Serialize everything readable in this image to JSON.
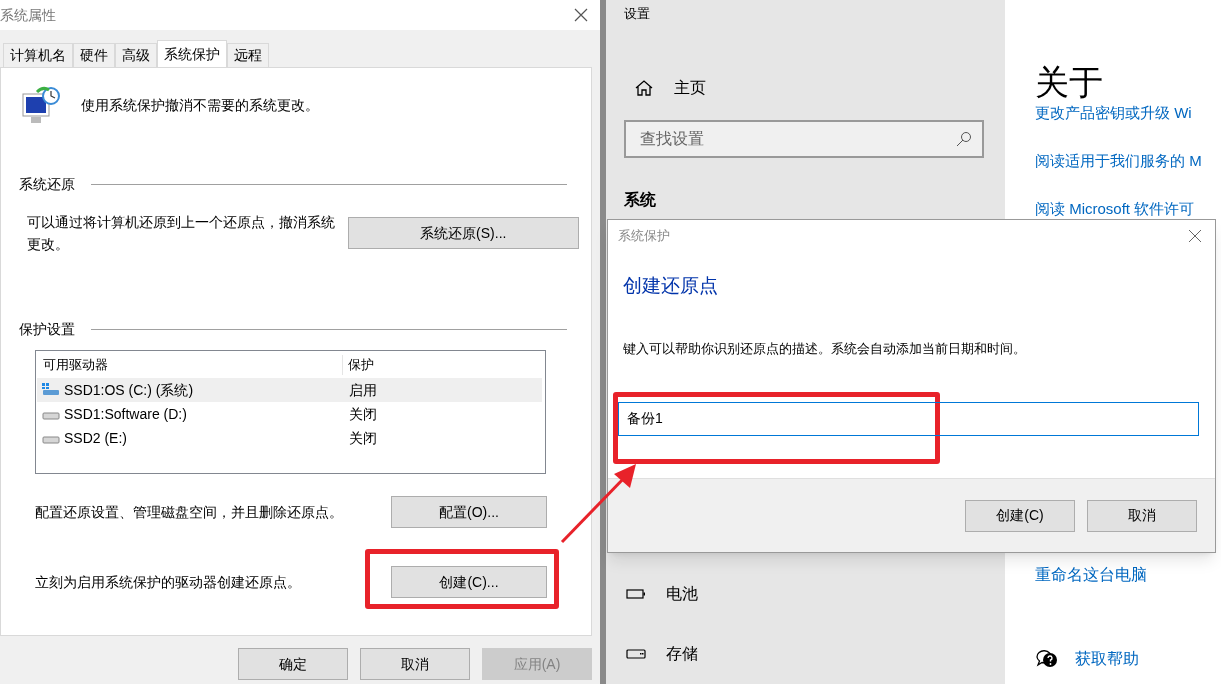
{
  "system_properties": {
    "title": "系统属性",
    "tabs": [
      {
        "label": "计算机名",
        "selected": false
      },
      {
        "label": "硬件",
        "selected": false
      },
      {
        "label": "高级",
        "selected": false
      },
      {
        "label": "系统保护",
        "selected": true
      },
      {
        "label": "远程",
        "selected": false
      }
    ],
    "intro": "使用系统保护撤消不需要的系统更改。",
    "restore": {
      "heading": "系统还原",
      "text": "可以通过将计算机还原到上一个还原点，撤消系统更改。",
      "button": "系统还原(S)..."
    },
    "protection": {
      "heading": "保护设置",
      "columns": [
        "可用驱动器",
        "保护"
      ],
      "drives": [
        {
          "kind": "system",
          "name": "SSD1:OS (C:) (系统)",
          "protection": "启用",
          "selected": true
        },
        {
          "kind": "drive",
          "name": "SSD1:Software (D:)",
          "protection": "关闭",
          "selected": false
        },
        {
          "kind": "drive",
          "name": "SSD2 (E:)",
          "protection": "关闭",
          "selected": false
        }
      ],
      "configure_text": "配置还原设置、管理磁盘空间，并且删除还原点。",
      "configure_button": "配置(O)...",
      "create_text": "立刻为启用系统保护的驱动器创建还原点。",
      "create_button": "创建(C)..."
    },
    "buttons": [
      {
        "label": "确定",
        "disabled": false
      },
      {
        "label": "取消",
        "disabled": false
      },
      {
        "label": "应用(A)",
        "disabled": true
      }
    ]
  },
  "settings": {
    "title": "设置",
    "home": "主页",
    "search": {
      "placeholder": "查找设置"
    },
    "section": "系统",
    "nav": [
      {
        "kind": "battery",
        "label": "电池"
      },
      {
        "kind": "storage",
        "label": "存储"
      }
    ],
    "heading": "关于",
    "links_top": [
      "更改产品密钥或升级 Wi",
      "阅读适用于我们服务的 M",
      "阅读 Microsoft 软件许可"
    ],
    "rename_link": "重命名这台电脑",
    "help_link": "获取帮助"
  },
  "dialog": {
    "title": "系统保护",
    "heading": "创建还原点",
    "description": "键入可以帮助你识别还原点的描述。系统会自动添加当前日期和时间。",
    "value": "备份1",
    "buttons": [
      "创建(C)",
      "取消"
    ]
  }
}
